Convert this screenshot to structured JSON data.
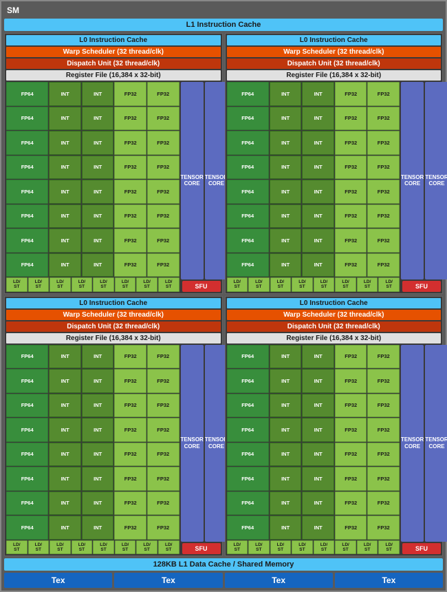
{
  "sm": {
    "title": "SM",
    "l1_instruction_cache": "L1 Instruction Cache",
    "l1_data_cache": "128KB L1 Data Cache / Shared Memory",
    "quadrants": [
      {
        "id": "q1",
        "l0_cache": "L0 Instruction Cache",
        "warp_scheduler": "Warp Scheduler (32 thread/clk)",
        "dispatch_unit": "Dispatch Unit (32 thread/clk)",
        "register_file": "Register File (16,384 x 32-bit)"
      },
      {
        "id": "q2",
        "l0_cache": "L0 Instruction Cache",
        "warp_scheduler": "Warp Scheduler (32 thread/clk)",
        "dispatch_unit": "Dispatch Unit (32 thread/clk)",
        "register_file": "Register File (16,384 x 32-bit)"
      },
      {
        "id": "q3",
        "l0_cache": "L0 Instruction Cache",
        "warp_scheduler": "Warp Scheduler (32 thread/clk)",
        "dispatch_unit": "Dispatch Unit (32 thread/clk)",
        "register_file": "Register File (16,384 x 32-bit)"
      },
      {
        "id": "q4",
        "l0_cache": "L0 Instruction Cache",
        "warp_scheduler": "Warp Scheduler (32 thread/clk)",
        "dispatch_unit": "Dispatch Unit (32 thread/clk)",
        "register_file": "Register File (16,384 x 32-bit)"
      }
    ],
    "core_rows": [
      [
        "FP64",
        "INT",
        "INT",
        "FP32",
        "FP32"
      ],
      [
        "FP64",
        "INT",
        "INT",
        "FP32",
        "FP32"
      ],
      [
        "FP64",
        "INT",
        "INT",
        "FP32",
        "FP32"
      ],
      [
        "FP64",
        "INT",
        "INT",
        "FP32",
        "FP32"
      ],
      [
        "FP64",
        "INT",
        "INT",
        "FP32",
        "FP32"
      ],
      [
        "FP64",
        "INT",
        "INT",
        "FP32",
        "FP32"
      ],
      [
        "FP64",
        "INT",
        "INT",
        "FP32",
        "FP32"
      ],
      [
        "FP64",
        "INT",
        "INT",
        "FP32",
        "FP32"
      ]
    ],
    "ld_st_cells": [
      "LD/ST",
      "LD/ST",
      "LD/ST",
      "LD/ST",
      "LD/ST",
      "LD/ST",
      "LD/ST",
      "LD/ST"
    ],
    "tensor_cores": [
      "TENSOR CORE",
      "TENSOR CORE"
    ],
    "sfu": "SFU",
    "tex_units": [
      "Tex",
      "Tex",
      "Tex",
      "Tex"
    ]
  }
}
